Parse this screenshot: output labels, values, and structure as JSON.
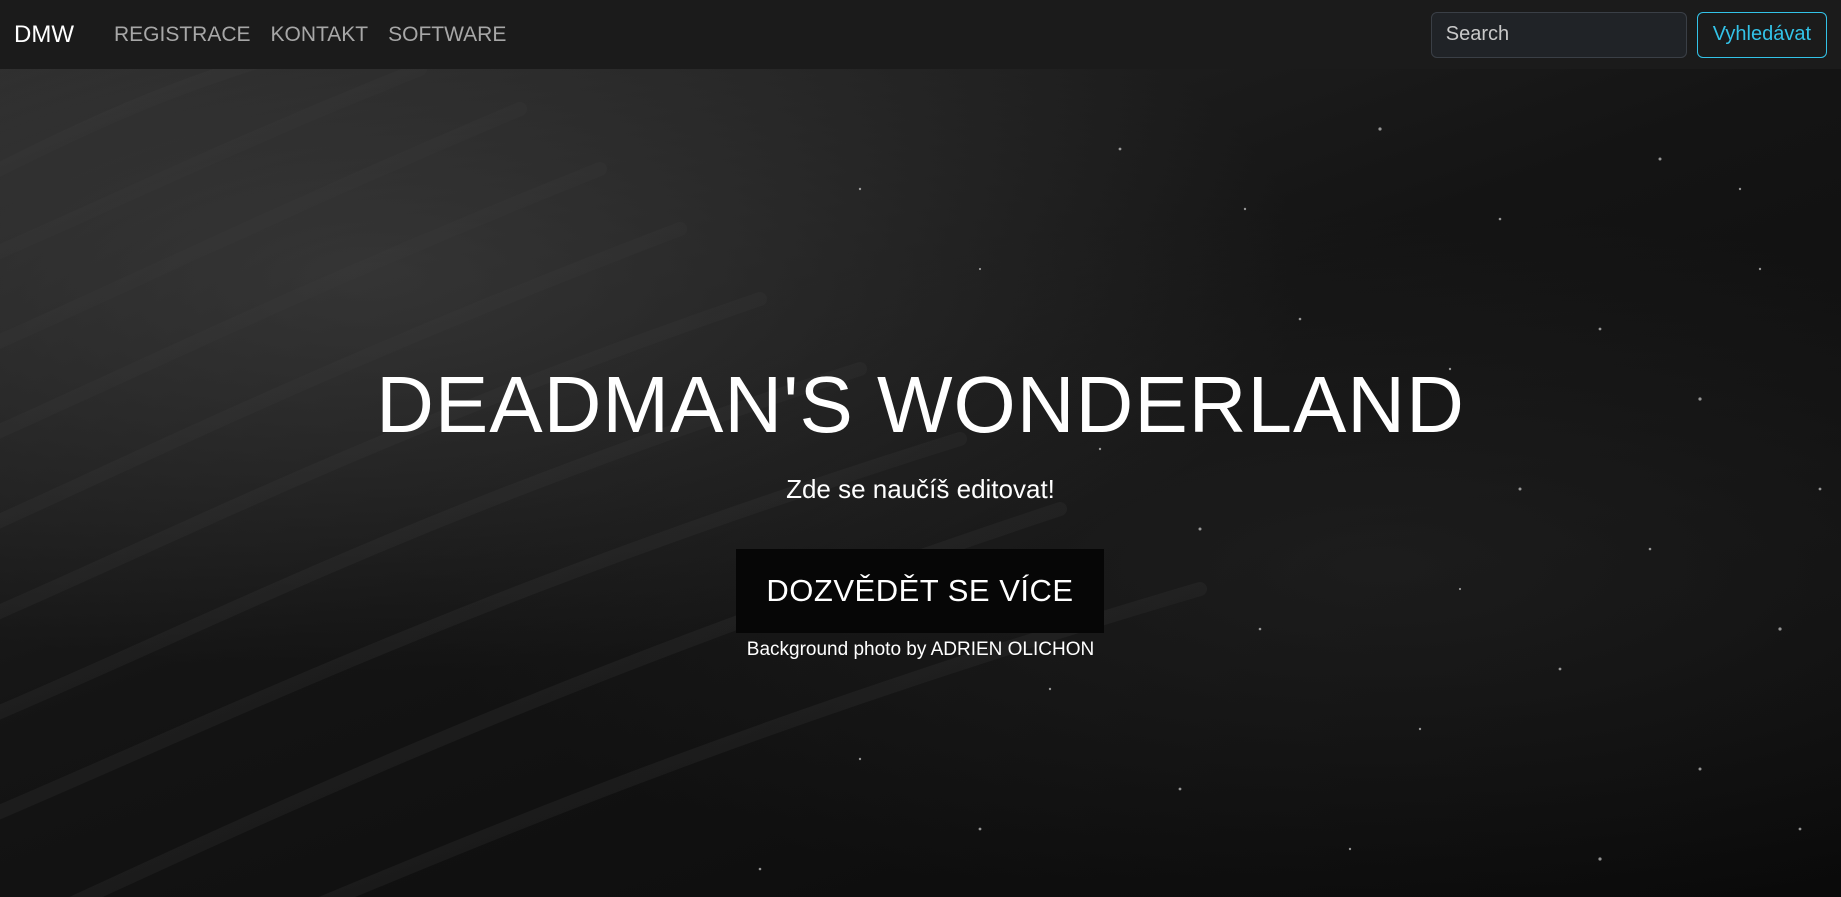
{
  "navbar": {
    "brand": "DMW",
    "links": [
      {
        "label": "REGISTRACE"
      },
      {
        "label": "KONTAKT"
      },
      {
        "label": "SOFTWARE"
      }
    ],
    "search": {
      "placeholder": "Search",
      "value": "",
      "button_label": "Vyhledávat"
    }
  },
  "hero": {
    "title": "DEADMAN'S WONDERLAND",
    "subtitle": "Zde se naučíš editovat!",
    "cta_label": "DOZVĚDĚT SE VÍCE",
    "credit": "Background photo by ADRIEN OLICHON"
  },
  "colors": {
    "navbar_bg": "#1b1b1b",
    "accent": "#33c3e8",
    "nav_link": "#a7a7a7",
    "text": "#ffffff"
  }
}
